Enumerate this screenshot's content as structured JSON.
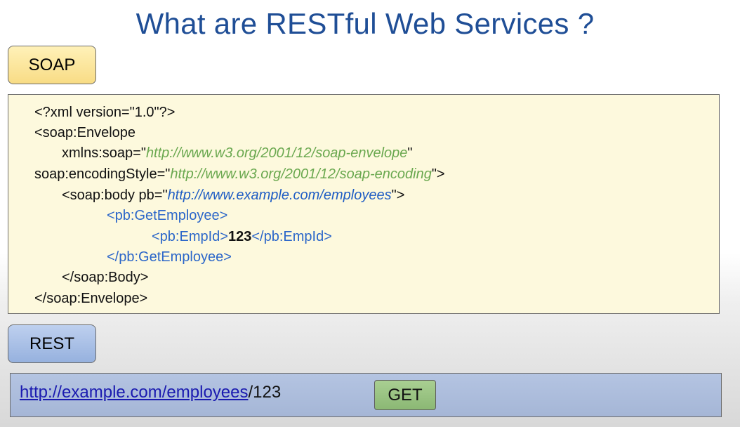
{
  "title": "What are RESTful Web Services ?",
  "soap": {
    "label": "SOAP",
    "xml_decl": "<?xml version=\"1.0\"?>",
    "envelope_open": "<soap:Envelope",
    "xmlns_prefix": "xmlns:soap=\"",
    "xmlns_url": "http://www.w3.org/2001/12/soap-envelope",
    "xmlns_suffix": "\"",
    "encoding_prefix": "soap:encodingStyle=\"",
    "encoding_url": "http://www.w3.org/2001/12/soap-encoding",
    "encoding_suffix": "\">",
    "body_prefix": "<soap:body pb=\"",
    "body_url": "http://www.example.com/employees",
    "body_suffix": "\">",
    "get_employee_open": "<pb:GetEmployee>",
    "emp_id_open": "<pb:EmpId>",
    "emp_id_value": "123",
    "emp_id_close": "</pb:EmpId>",
    "get_employee_close": "</pb:GetEmployee>",
    "body_close": "</soap:Body>",
    "envelope_close": "</soap:Envelope>"
  },
  "rest": {
    "label": "REST",
    "url_link": "http://example.com/employees",
    "url_suffix": "/123",
    "method": "GET"
  },
  "colors": {
    "title": "#1f4e96",
    "soap_tag": "#f8dc85",
    "rest_tag": "#96b1de",
    "url_green": "#6aa84f",
    "url_blue": "#1f5dc4",
    "get_button": "#8bb874"
  }
}
